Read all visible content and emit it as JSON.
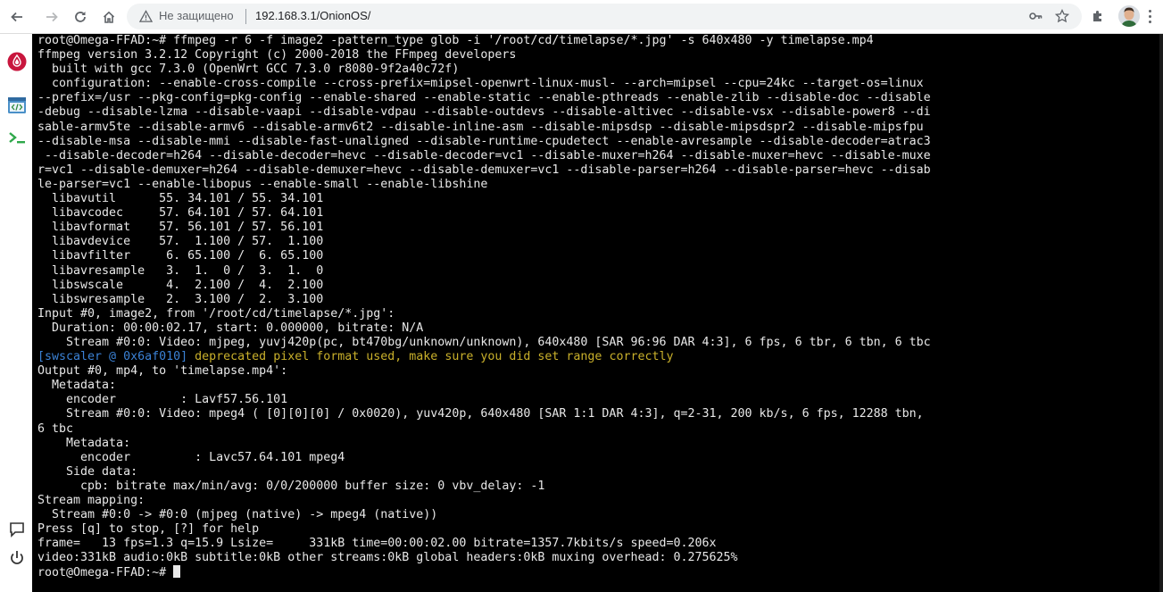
{
  "browser": {
    "security_text": "Не защищено",
    "url": "192.168.3.1/OnionOS/"
  },
  "sidebar": {
    "items": [
      {
        "icon": "onion-logo-icon"
      },
      {
        "icon": "code-editor-icon"
      },
      {
        "icon": "terminal-icon"
      },
      {
        "icon": "chat-icon"
      },
      {
        "icon": "power-icon"
      }
    ]
  },
  "colors": {
    "terminal_bg": "#000000",
    "terminal_text": "#e8e8e8",
    "swscaler_tag": "#3b82d6",
    "warning_text": "#c9b02b",
    "onion_logo": "#c8163d"
  },
  "terminal": {
    "lines": [
      "root@Omega-FFAD:~# ffmpeg -r 6 -f image2 -pattern_type glob -i '/root/cd/timelapse/*.jpg' -s 640x480 -y timelapse.mp4",
      "ffmpeg version 3.2.12 Copyright (c) 2000-2018 the FFmpeg developers",
      "  built with gcc 7.3.0 (OpenWrt GCC 7.3.0 r8080-9f2a40c72f)",
      "  configuration: --enable-cross-compile --cross-prefix=mipsel-openwrt-linux-musl- --arch=mipsel --cpu=24kc --target-os=linux",
      "--prefix=/usr --pkg-config=pkg-config --enable-shared --enable-static --enable-pthreads --enable-zlib --disable-doc --disable",
      "-debug --disable-lzma --disable-vaapi --disable-vdpau --disable-outdevs --disable-altivec --disable-vsx --disable-power8 --di",
      "sable-armv5te --disable-armv6 --disable-armv6t2 --disable-inline-asm --disable-mipsdsp --disable-mipsdspr2 --disable-mipsfpu",
      "--disable-msa --disable-mmi --disable-fast-unaligned --disable-runtime-cpudetect --enable-avresample --disable-decoder=atrac3",
      " --disable-decoder=h264 --disable-decoder=hevc --disable-decoder=vc1 --disable-muxer=h264 --disable-muxer=hevc --disable-muxe",
      "r=vc1 --disable-demuxer=h264 --disable-demuxer=hevc --disable-demuxer=vc1 --disable-parser=h264 --disable-parser=hevc --disab",
      "le-parser=vc1 --enable-libopus --enable-small --enable-libshine",
      "  libavutil      55. 34.101 / 55. 34.101",
      "  libavcodec     57. 64.101 / 57. 64.101",
      "  libavformat    57. 56.101 / 57. 56.101",
      "  libavdevice    57.  1.100 / 57.  1.100",
      "  libavfilter     6. 65.100 /  6. 65.100",
      "  libavresample   3.  1.  0 /  3.  1.  0",
      "  libswscale      4.  2.100 /  4.  2.100",
      "  libswresample   2.  3.100 /  2.  3.100",
      "Input #0, image2, from '/root/cd/timelapse/*.jpg':",
      "  Duration: 00:00:02.17, start: 0.000000, bitrate: N/A",
      "    Stream #0:0: Video: mjpeg, yuvj420p(pc, bt470bg/unknown/unknown), 640x480 [SAR 96:96 DAR 4:3], 6 fps, 6 tbr, 6 tbn, 6 tbc",
      "__SWSCALER__",
      "Output #0, mp4, to 'timelapse.mp4':",
      "  Metadata:",
      "    encoder         : Lavf57.56.101",
      "    Stream #0:0: Video: mpeg4 ( [0][0][0] / 0x0020), yuv420p, 640x480 [SAR 1:1 DAR 4:3], q=2-31, 200 kb/s, 6 fps, 12288 tbn,",
      "6 tbc",
      "    Metadata:",
      "      encoder         : Lavc57.64.101 mpeg4",
      "    Side data:",
      "      cpb: bitrate max/min/avg: 0/0/200000 buffer size: 0 vbv_delay: -1",
      "Stream mapping:",
      "  Stream #0:0 -> #0:0 (mjpeg (native) -> mpeg4 (native))",
      "Press [q] to stop, [?] for help",
      "frame=   13 fps=1.3 q=15.9 Lsize=     331kB time=00:00:02.00 bitrate=1357.7kbits/s speed=0.206x",
      "video:331kB audio:0kB subtitle:0kB other streams:0kB global headers:0kB muxing overhead: 0.275625%",
      "__PROMPT__"
    ],
    "swscaler_tag": "[swscaler @ 0x6af010]",
    "swscaler_message": " deprecated pixel format used, make sure you did set range correctly",
    "prompt": "root@Omega-FFAD:~# "
  }
}
